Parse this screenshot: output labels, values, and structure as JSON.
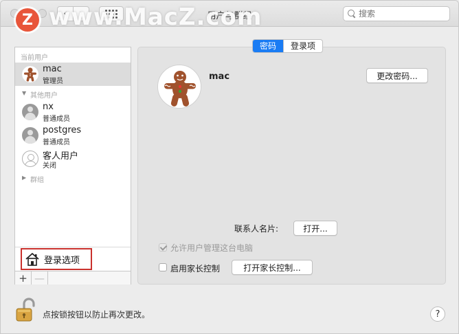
{
  "window": {
    "title": "用户与群组",
    "search_placeholder": "搜索"
  },
  "watermark": {
    "logo_letter": "Z",
    "text": "www.MacZ.com"
  },
  "sidebar": {
    "current_users_label": "当前用户",
    "current_user": {
      "name": "mac",
      "role": "管理员",
      "avatar": "gingerbread-icon"
    },
    "other_users_label": "其他用户",
    "other_users": [
      {
        "name": "nx",
        "role": "普通成员",
        "avatar": "generic-user-icon"
      },
      {
        "name": "postgres",
        "role": "普通成员",
        "avatar": "generic-user-icon"
      },
      {
        "name": "客人用户",
        "role": "关闭",
        "avatar": "guest-user-icon"
      }
    ],
    "groups_label": "群组",
    "login_options_label": "登录选项",
    "add_label": "+",
    "remove_label": "—"
  },
  "main": {
    "tabs": [
      {
        "label": "密码",
        "active": true
      },
      {
        "label": "登录项",
        "active": false
      }
    ],
    "user_name": "mac",
    "change_password_label": "更改密码...",
    "contact_card_label": "联系人名片:",
    "open_label": "打开...",
    "allow_admin_label": "允许用户管理这台电脑",
    "allow_admin_checked": true,
    "parental_controls_label": "启用家长控制",
    "parental_controls_checked": false,
    "open_parental_label": "打开家长控制..."
  },
  "footer": {
    "lock_text": "点按锁按钮以防止再次更改。",
    "help_label": "?"
  },
  "colors": {
    "accent": "#1a7cf4",
    "highlight_box": "#c9302c",
    "selected_row": "#dcdcdc"
  }
}
